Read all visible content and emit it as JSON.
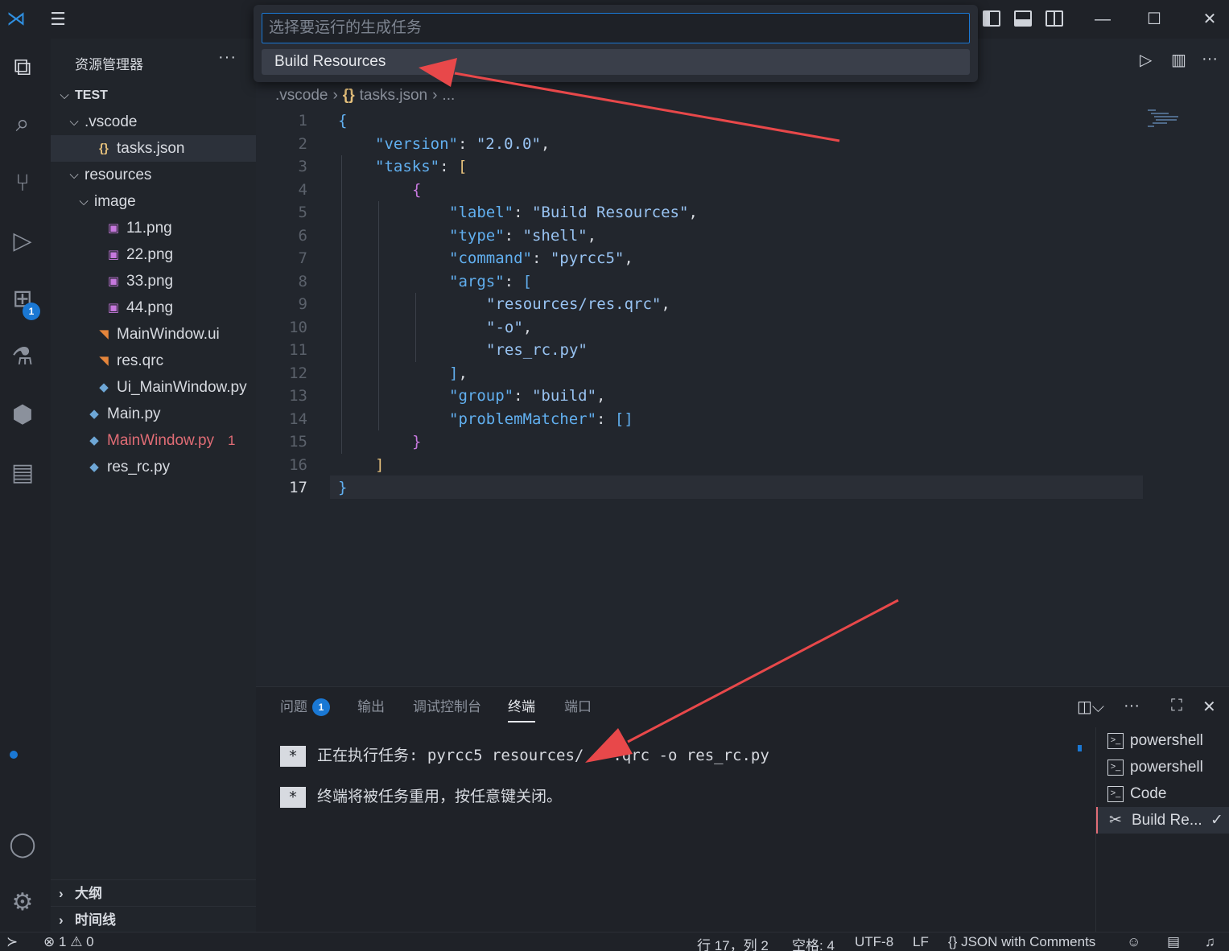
{
  "quick_pick": {
    "placeholder": "选择要运行的生成任务",
    "items": [
      "Build Resources"
    ]
  },
  "sidebar": {
    "title": "资源管理器",
    "more": "···",
    "tree": [
      {
        "label": "TEST",
        "indent": 0,
        "chevron": "⌵",
        "icon": "",
        "bold": true
      },
      {
        "label": ".vscode",
        "indent": 1,
        "chevron": "⌵",
        "icon": ""
      },
      {
        "label": "tasks.json",
        "indent": 2,
        "chevron": "",
        "icon": "{}",
        "iconColor": "#e5c07b",
        "selected": true
      },
      {
        "label": "resources",
        "indent": 1,
        "chevron": "⌵",
        "icon": ""
      },
      {
        "label": "image",
        "indent": 2,
        "chevron": "⌵",
        "icon": ""
      },
      {
        "label": "11.png",
        "indent": 3,
        "chevron": "",
        "icon": "▣",
        "iconColor": "#c678dd"
      },
      {
        "label": "22.png",
        "indent": 3,
        "chevron": "",
        "icon": "▣",
        "iconColor": "#c678dd"
      },
      {
        "label": "33.png",
        "indent": 3,
        "chevron": "",
        "icon": "▣",
        "iconColor": "#c678dd"
      },
      {
        "label": "44.png",
        "indent": 3,
        "chevron": "",
        "icon": "▣",
        "iconColor": "#c678dd"
      },
      {
        "label": "MainWindow.ui",
        "indent": 2,
        "chevron": "",
        "icon": "◥",
        "iconColor": "#e5853b"
      },
      {
        "label": "res.qrc",
        "indent": 2,
        "chevron": "",
        "icon": "◥",
        "iconColor": "#e5853b"
      },
      {
        "label": "Ui_MainWindow.py",
        "indent": 2,
        "chevron": "",
        "icon": "◆",
        "iconColor": "#6ea7d6"
      },
      {
        "label": "Main.py",
        "indent": 1,
        "chevron": "",
        "icon": "◆",
        "iconColor": "#6ea7d6"
      },
      {
        "label": "MainWindow.py",
        "indent": 1,
        "chevron": "",
        "icon": "◆",
        "iconColor": "#6ea7d6",
        "error": true,
        "errors": "1"
      },
      {
        "label": "res_rc.py",
        "indent": 1,
        "chevron": "",
        "icon": "◆",
        "iconColor": "#6ea7d6"
      }
    ],
    "outline_label": "大纲",
    "timeline_label": "时间线"
  },
  "activity_badge": "1",
  "editor": {
    "breadcrumb": [
      ".vscode",
      "tasks.json",
      "..."
    ],
    "current_line": 17,
    "lines": [
      [
        [
          "b1",
          "{"
        ]
      ],
      [
        [
          "k",
          "\"version\""
        ],
        [
          "p",
          ": "
        ],
        [
          "s",
          "\"2.0.0\""
        ],
        [
          "p",
          ","
        ]
      ],
      [
        [
          "k",
          "\"tasks\""
        ],
        [
          "p",
          ": "
        ],
        [
          "b2",
          "["
        ]
      ],
      [
        [
          "b3",
          "{"
        ]
      ],
      [
        [
          "k",
          "\"label\""
        ],
        [
          "p",
          ": "
        ],
        [
          "s",
          "\"Build Resources\""
        ],
        [
          "p",
          ","
        ]
      ],
      [
        [
          "k",
          "\"type\""
        ],
        [
          "p",
          ": "
        ],
        [
          "s",
          "\"shell\""
        ],
        [
          "p",
          ","
        ]
      ],
      [
        [
          "k",
          "\"command\""
        ],
        [
          "p",
          ": "
        ],
        [
          "s",
          "\"pyrcc5\""
        ],
        [
          "p",
          ","
        ]
      ],
      [
        [
          "k",
          "\"args\""
        ],
        [
          "p",
          ": "
        ],
        [
          "b1",
          "["
        ]
      ],
      [
        [
          "s",
          "\"resources/res.qrc\""
        ],
        [
          "p",
          ","
        ]
      ],
      [
        [
          "s",
          "\"-o\""
        ],
        [
          "p",
          ","
        ]
      ],
      [
        [
          "s",
          "\"res_rc.py\""
        ]
      ],
      [
        [
          "b1",
          "]"
        ],
        [
          "p",
          ","
        ]
      ],
      [
        [
          "k",
          "\"group\""
        ],
        [
          "p",
          ": "
        ],
        [
          "s",
          "\"build\""
        ],
        [
          "p",
          ","
        ]
      ],
      [
        [
          "k",
          "\"problemMatcher\""
        ],
        [
          "p",
          ": "
        ],
        [
          "b1",
          "[]"
        ]
      ],
      [
        [
          "b3",
          "}"
        ]
      ],
      [
        [
          "b2",
          "]"
        ]
      ],
      [
        [
          "b1",
          "}"
        ]
      ]
    ],
    "indents": [
      0,
      1,
      1,
      2,
      3,
      3,
      3,
      3,
      4,
      4,
      4,
      3,
      3,
      3,
      2,
      1,
      0
    ]
  },
  "panel": {
    "tabs": [
      "问题",
      "输出",
      "调试控制台",
      "终端",
      "端口"
    ],
    "problems_badge": "1",
    "active_tab": "终端",
    "terminal_lines": [
      "正在执行任务: pyrcc5 resources/",
      "终端将被任务重用，按任意键关闭。"
    ],
    "terminal_line1_tail": ".qrc -o res_rc.py",
    "terminals": [
      "powershell",
      "powershell",
      "Code",
      "Build Re..."
    ]
  },
  "statusbar": {
    "errors": "1",
    "warnings": "0",
    "position": "行 17，列 2",
    "spaces": "空格: 4",
    "encoding": "UTF-8",
    "eol": "LF",
    "language": "JSON with Comments"
  },
  "colors": {
    "accent": "#1a78d4",
    "error": "#e06c75",
    "arrow": "#e8484a"
  }
}
